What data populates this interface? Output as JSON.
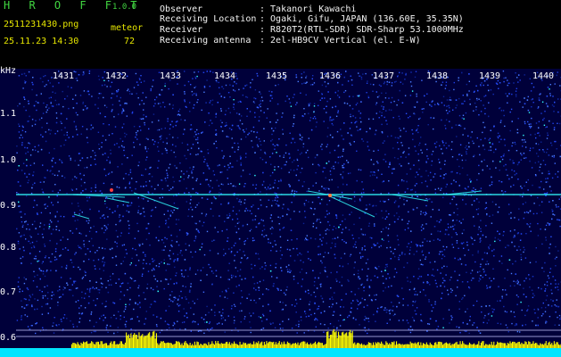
{
  "header": {
    "app_name": "H R O F F T",
    "version": "1.0.0",
    "filename": "2511231430.png",
    "datetime": "25.11.23 14:30",
    "mode_label": "meteor",
    "meteor_count": "72",
    "info_labels": [
      "Observer",
      "Receiving Location",
      "Receiver",
      "Receiving antenna"
    ],
    "info_values": [
      ": Takanori Kawachi",
      ": Ogaki, Gifu, JAPAN (136.60E, 35.35N)",
      ": R820T2(RTL-SDR) SDR-Sharp 53.1000MHz",
      ": 2el-HB9CV Vertical (el. E-W)"
    ]
  },
  "axes": {
    "y_unit": "kHz",
    "y_ticks": [
      "1.1",
      "1.0",
      "0.9",
      "0.8",
      "0.7",
      "0.6"
    ],
    "x_ticks": [
      "1431",
      "1432",
      "1433",
      "1434",
      "1435",
      "1436",
      "1437",
      "1438",
      "1439",
      "1440"
    ]
  },
  "colors": {
    "background": "#00003a",
    "noise_blue": "#1f3fe6",
    "trace_cyan": "#33ffff",
    "bar_yellow": "#ffff00",
    "bottom_cyan": "#00e5ff"
  }
}
